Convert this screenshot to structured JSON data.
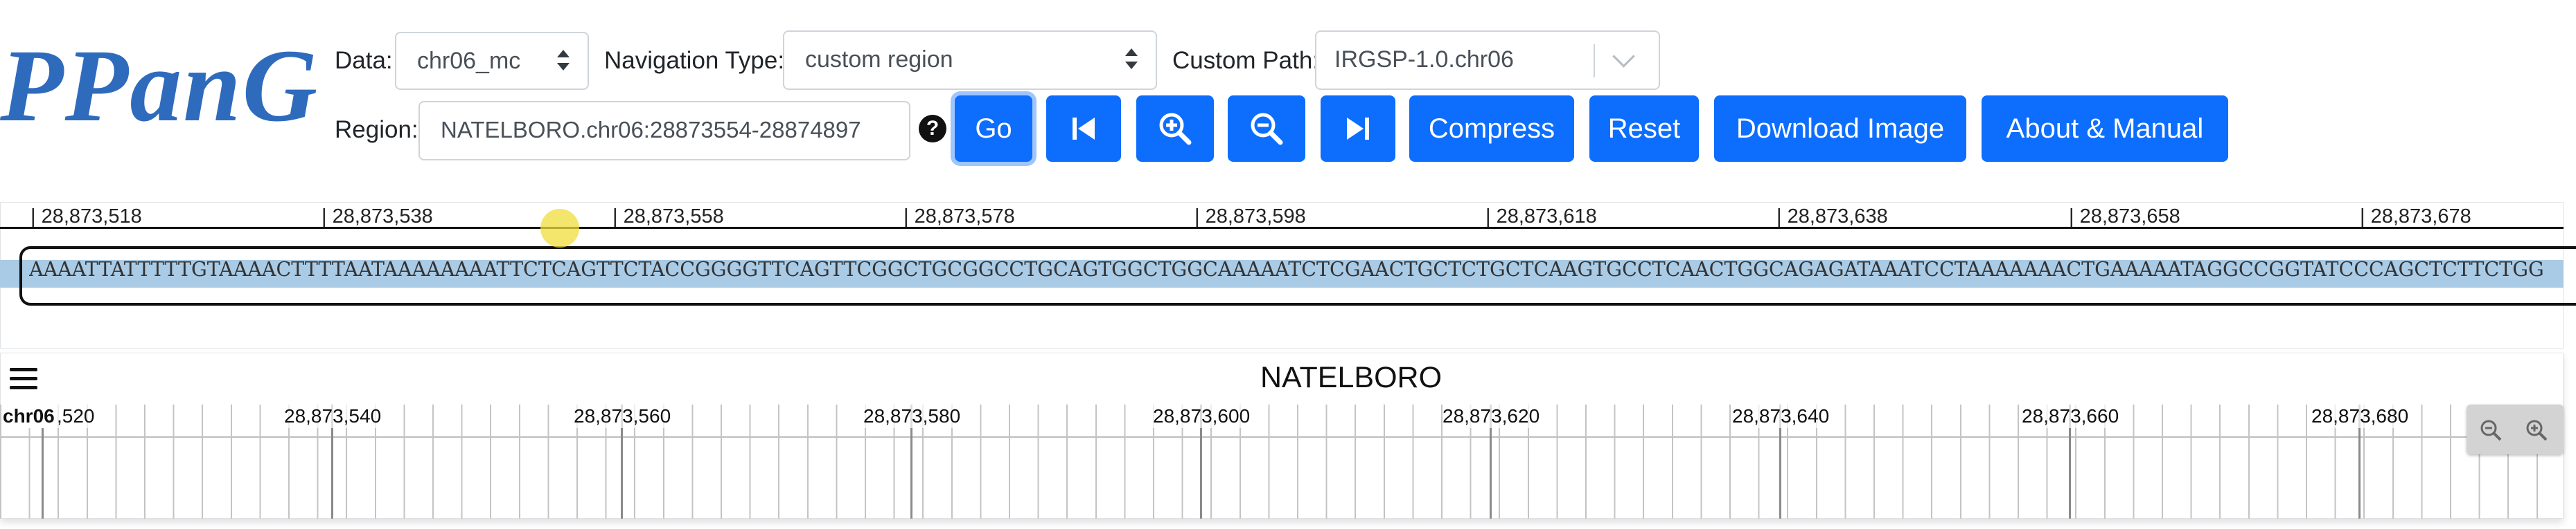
{
  "app": {
    "logo": "PPanG"
  },
  "controls": {
    "data_label": "Data:",
    "data_value": "chr06_mc",
    "nav_type_label": "Navigation Type:",
    "nav_type_value": "custom region",
    "custom_path_label": "Custom Path:",
    "custom_path_value": "IRGSP-1.0.chr06",
    "region_label": "Region:",
    "region_value": "NATELBORO.chr06:28873554-28874897",
    "help_glyph": "?"
  },
  "buttons": {
    "go": "Go",
    "first_icon": "skip-backward-icon",
    "zoom_in_icon": "zoom-in-icon",
    "zoom_out_icon": "zoom-out-icon",
    "last_icon": "skip-forward-icon",
    "compress": "Compress",
    "reset": "Reset",
    "download": "Download Image",
    "about": "About & Manual"
  },
  "sequence_view": {
    "ruler_ticks": [
      "| 28,873,518",
      "| 28,873,538",
      "| 28,873,558",
      "| 28,873,578",
      "| 28,873,598",
      "| 28,873,618",
      "| 28,873,638",
      "| 28,873,658",
      "| 28,873,678"
    ],
    "sequence": "AAAATTATTTTTGTAAAACTTTTAATAAAAAAAATTCTCAGTTCTACCGGGGTTCAGTTCGGCTGCGGCCTGCAGTGGCTGGCAAAAATCTCGAACTGCTCTGCTCAAGTGCCTCAACTGGCAGAGATAAATCCTAAAAAAACTGAAAAATAGGCCGGTATCCCAGCTCTTCTGG",
    "colors": {
      "band": "#aacbe6",
      "accent": "#0d6efd",
      "logo": "#2f6bbd"
    }
  },
  "genome_view": {
    "menu_icon": "hamburger-menu-icon",
    "title": "NATELBORO",
    "chrom": "chr06",
    "first_tick": ",520",
    "ticks": [
      "28,873,540",
      "28,873,560",
      "28,873,580",
      "28,873,600",
      "28,873,620",
      "28,873,640",
      "28,873,660",
      "28,873,680"
    ],
    "zoom_out_icon": "zoom-out-icon",
    "zoom_in_icon": "zoom-in-icon"
  }
}
